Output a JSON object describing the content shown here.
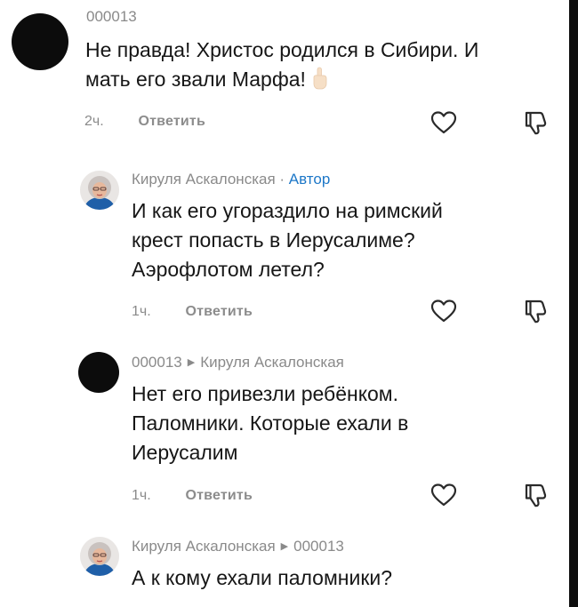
{
  "comments": [
    {
      "author": "000013",
      "text_lines": [
        "Не правда! Христос родился в Сибири. И",
        "мать его звали Марфа!"
      ],
      "emoji": "pointing-finger-emoji",
      "time": "2ч.",
      "reply_label": "Ответить"
    },
    {
      "author": "Кируля Аскалонская",
      "separator": " · ",
      "badge": "Автор",
      "text_lines": [
        "И как его угораздило на римский",
        "крест попасть в Иерусалиме?",
        "Аэрофлотом летел?"
      ],
      "time": "1ч.",
      "reply_label": "Ответить"
    },
    {
      "author": "000013",
      "reply_to": "Кируля Аскалонская",
      "text_lines": [
        "Нет его привезли ребёнком.",
        "Паломники. Которые ехали в",
        "Иерусалим"
      ],
      "time": "1ч.",
      "reply_label": "Ответить"
    },
    {
      "author": "Кируля Аскалонская",
      "reply_to": "000013",
      "text_lines": [
        "А к кому ехали паломники?"
      ]
    }
  ],
  "icons": {
    "like": "heart-outline-icon",
    "dislike": "thumbs-down-outline-icon",
    "reply_arrow": "caret-right-icon"
  },
  "colors": {
    "author_badge": "#1e78c8",
    "meta_text": "#8a8a8a",
    "body_text": "#161616"
  }
}
